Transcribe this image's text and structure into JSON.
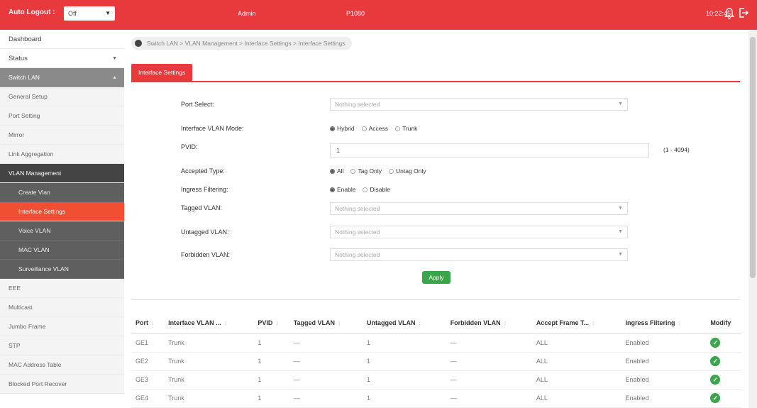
{
  "topbar": {
    "auto_logout_label": "Auto Logout :",
    "auto_logout_value": "Off",
    "user": "Admin",
    "model": "P1080",
    "time": "10:22:45"
  },
  "sidebar": {
    "items": [
      {
        "label": "Dashboard"
      },
      {
        "label": "Status"
      },
      {
        "label": "Switch LAN"
      },
      {
        "label": "General Setup"
      },
      {
        "label": "Port Setting"
      },
      {
        "label": "Mirror"
      },
      {
        "label": "Link Aggregation"
      },
      {
        "label": "VLAN Management"
      },
      {
        "label": "Create Vlan"
      },
      {
        "label": "Interface Settings"
      },
      {
        "label": "Voice VLAN"
      },
      {
        "label": "MAC VLAN"
      },
      {
        "label": "Surveillance VLAN"
      },
      {
        "label": "EEE"
      },
      {
        "label": "Multicast"
      },
      {
        "label": "Jumbo Frame"
      },
      {
        "label": "STP"
      },
      {
        "label": "MAC Address Table"
      },
      {
        "label": "Blocked Port Recover"
      }
    ]
  },
  "breadcrumb": "Switch LAN > VLAN Management > Interface Settings > Interface Settings",
  "tab_label": "Interface Settings",
  "form": {
    "port_select_label": "Port Select:",
    "port_select_placeholder": "Nothing selected",
    "mode_label": "Interface VLAN Mode:",
    "mode_options": [
      "Hybrid",
      "Access",
      "Trunk"
    ],
    "mode_selected": "Hybrid",
    "pvid_label": "PVID:",
    "pvid_value": "1",
    "pvid_range": "(1 - 4094)",
    "accepted_label": "Accepted Type:",
    "accepted_options": [
      "All",
      "Tag Only",
      "Untag Only"
    ],
    "accepted_selected": "All",
    "ingress_label": "Ingress Filtering:",
    "ingress_options": [
      "Enable",
      "Disable"
    ],
    "ingress_selected": "Enable",
    "tagged_label": "Tagged VLAN:",
    "tagged_placeholder": "Nothing selected",
    "untagged_label": "Untagged VLAN:",
    "untagged_placeholder": "Nothing selected",
    "forbidden_label": "Forbidden VLAN:",
    "forbidden_placeholder": "Nothing selected",
    "apply_label": "Apply"
  },
  "table": {
    "headers": [
      "Port",
      "Interface VLAN ...",
      "PVID",
      "Tagged VLAN",
      "Untagged VLAN",
      "Forbidden VLAN",
      "Accept Frame T...",
      "Ingress Filtering",
      "Modify"
    ],
    "rows": [
      [
        "GE1",
        "Trunk",
        "1",
        "—",
        "1",
        "—",
        "ALL",
        "Enabled"
      ],
      [
        "GE2",
        "Trunk",
        "1",
        "—",
        "1",
        "—",
        "ALL",
        "Enabled"
      ],
      [
        "GE3",
        "Trunk",
        "1",
        "—",
        "1",
        "—",
        "ALL",
        "Enabled"
      ],
      [
        "GE4",
        "Trunk",
        "1",
        "—",
        "1",
        "—",
        "ALL",
        "Enabled"
      ]
    ]
  },
  "colors": {
    "brand_red": "#e8393d",
    "active_orange": "#f04f32",
    "apply_green": "#3aa64a"
  }
}
